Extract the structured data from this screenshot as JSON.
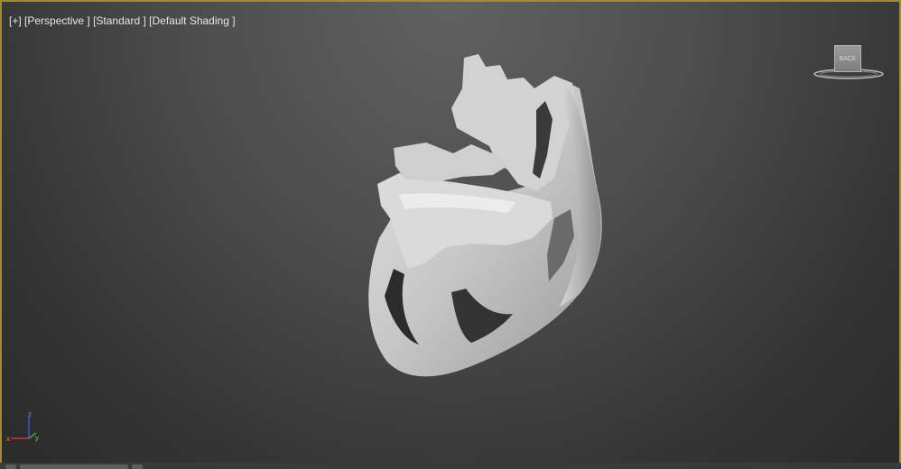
{
  "viewport": {
    "label_plus": "[+]",
    "label_view": "[Perspective ]",
    "label_mode": "[Standard ]",
    "label_shading": "[Default Shading ]"
  },
  "viewcube": {
    "face_label": "BACK"
  },
  "gizmo": {
    "z_label": "z",
    "x_label": "x",
    "y_label": "y",
    "x_color": "#d23a2a",
    "y_color": "#3fae3f",
    "z_color": "#3a54d8"
  },
  "colors": {
    "viewport_border": "#a08a3c",
    "model_color": "#c9c9c9"
  }
}
